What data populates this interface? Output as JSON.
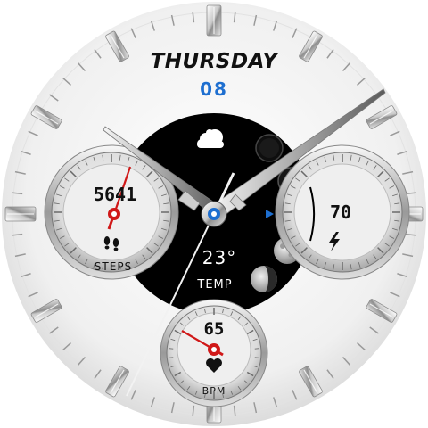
{
  "date": {
    "weekday": "THURSDAY",
    "day": "08"
  },
  "steps": {
    "count": "5641",
    "label": "STEPS"
  },
  "battery": {
    "level": "70",
    "icon": "lightning-icon"
  },
  "weather": {
    "temperature": "23°",
    "label": "TEMP",
    "icon": "cloud-icon"
  },
  "heart_rate": {
    "value": "65",
    "label": "BPM",
    "icon": "heart-icon"
  },
  "moon_phases": [
    "new-moon-icon",
    "waxing-crescent-icon",
    "first-quarter-icon",
    "full-moon-icon",
    "waning-gibbous-icon"
  ],
  "colors": {
    "accent_blue": "#1e6fd0",
    "hand_red": "#d01818",
    "dial": "#f0f0f0",
    "center": "#000000"
  }
}
